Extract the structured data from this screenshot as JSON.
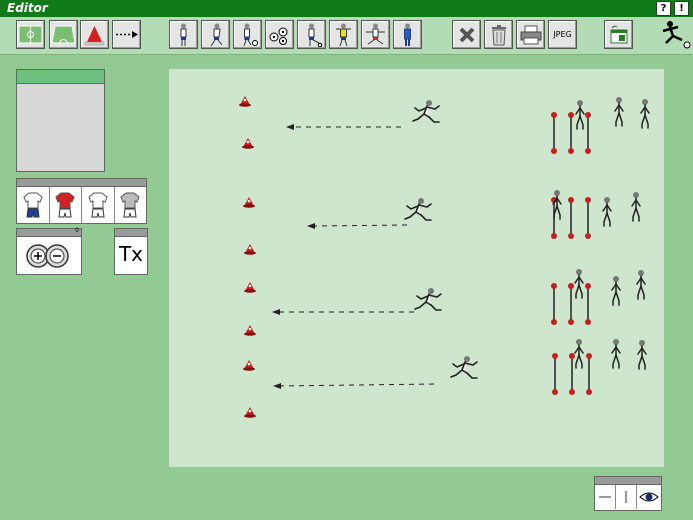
{
  "window": {
    "title": "Editor",
    "help_label": "?",
    "info_label": "!"
  },
  "toolbar": {
    "tools": [
      {
        "name": "pitch-full-tool",
        "icon": "pitch-full-icon"
      },
      {
        "name": "pitch-half-tool",
        "icon": "pitch-half-icon"
      },
      {
        "name": "cone-tool",
        "icon": "cone-icon"
      },
      {
        "name": "arrow-tool",
        "icon": "dashed-arrow-icon"
      },
      {
        "name": "player-standing-tool",
        "icon": "player-standing-icon"
      },
      {
        "name": "player-running-tool",
        "icon": "player-running-icon"
      },
      {
        "name": "player-dribbling-tool",
        "icon": "player-dribbling-icon"
      },
      {
        "name": "balls-tool",
        "icon": "balls-icon"
      },
      {
        "name": "player-kicking-tool",
        "icon": "player-kicking-icon"
      },
      {
        "name": "goalkeeper-tool",
        "icon": "goalkeeper-icon"
      },
      {
        "name": "player-jumping-tool",
        "icon": "player-jumping-icon"
      },
      {
        "name": "coach-tool",
        "icon": "coach-icon"
      }
    ],
    "delete_icon": "delete-x-icon",
    "trash_icon": "trash-icon",
    "print_icon": "printer-icon",
    "jpeg_label": "JPEG",
    "window_icon": "window-icon"
  },
  "left_panel": {
    "counter_badge": "0",
    "text_label": "Tx"
  },
  "colors": {
    "field": "#cde6cd",
    "background": "#93c993",
    "title_bar": "#0e7a18",
    "cone": "#c42020"
  }
}
